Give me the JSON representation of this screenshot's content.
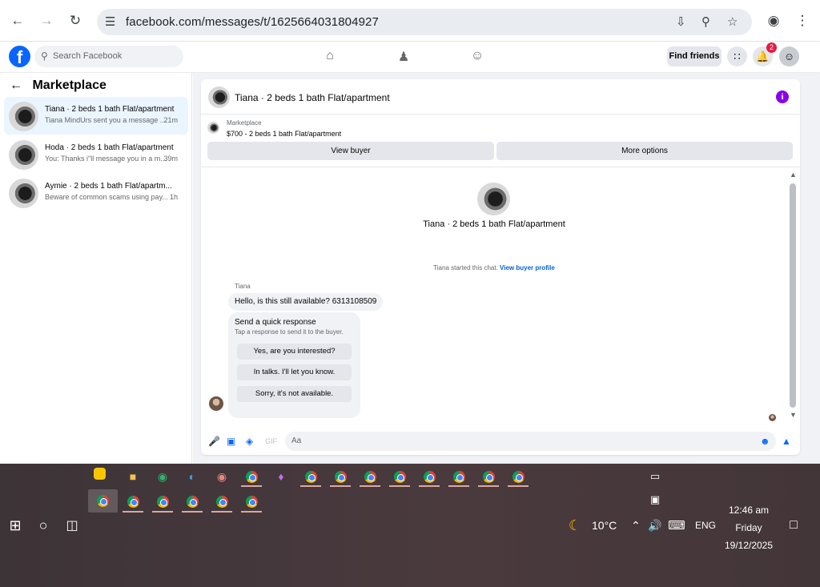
{
  "browser": {
    "url": "facebook.com/messages/t/1625664031804927"
  },
  "facebook": {
    "search_placeholder": "Search Facebook",
    "find_friends": "Find friends",
    "notification_count": "2"
  },
  "sidebar": {
    "title": "Marketplace",
    "conversations": [
      {
        "name": "Tiana · 2 beds 1 bath Flat/apartment",
        "preview": "Tiana MindUrs sent you a message ...",
        "time": "21m"
      },
      {
        "name": "Hoda · 2 beds 1 bath Flat/apartment",
        "preview": "You: Thanks i\"ll message you in a m...",
        "time": "39m"
      },
      {
        "name": "Aymie · 2 beds 1 bath Flat/apartm...",
        "preview": "Beware of common scams using pay...",
        "time": "1h"
      }
    ]
  },
  "chat": {
    "header_title": "Tiana · 2 beds 1 bath Flat/apartment",
    "marketplace_label": "Marketplace",
    "listing": "$700 - 2 beds 1 bath Flat/apartment",
    "view_buyer": "View buyer",
    "more_options": "More options",
    "contact_name": "Tiana · 2 beds 1 bath Flat/apartment",
    "started_text": "Tiana started this chat.",
    "view_profile": "View buyer profile",
    "sender": "Tiana",
    "message": "Hello, is this still available? 6313108509",
    "quick_title": "Send a quick response",
    "quick_sub": "Tap a response to send it to the buyer.",
    "quick_replies": [
      "Yes, are you interested?",
      "In talks. I'll let you know.",
      "Sorry, it's not available."
    ],
    "input_placeholder": "Aa"
  },
  "taskbar": {
    "weather": "10°C",
    "language": "ENG",
    "time": "12:46 am",
    "day": "Friday",
    "date": "19/12/2025"
  }
}
